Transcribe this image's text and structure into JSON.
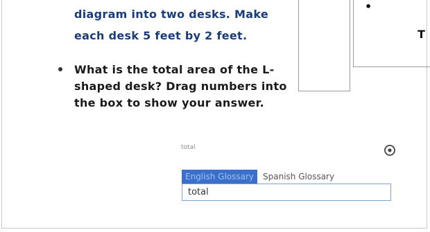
{
  "question": {
    "line1": "diagram into two desks. Make",
    "line2": "each desk 5 feet by 2 feet.",
    "bullet": "What is the total area of the L-shaped desk? Drag numbers into the box to show your answer."
  },
  "diagram": {
    "label_partial": "T",
    "mark": "•"
  },
  "glossary": {
    "term_label": "total",
    "tabs": [
      "English Glossary",
      "Spanish Glossary"
    ],
    "active_tab": "English Glossary",
    "entry": "total"
  },
  "icons": {
    "target": "target-icon"
  },
  "colors": {
    "heading_text": "#1a3d7a",
    "active_tab_bg": "#3a70cc",
    "field_border": "#7ca0d4"
  }
}
